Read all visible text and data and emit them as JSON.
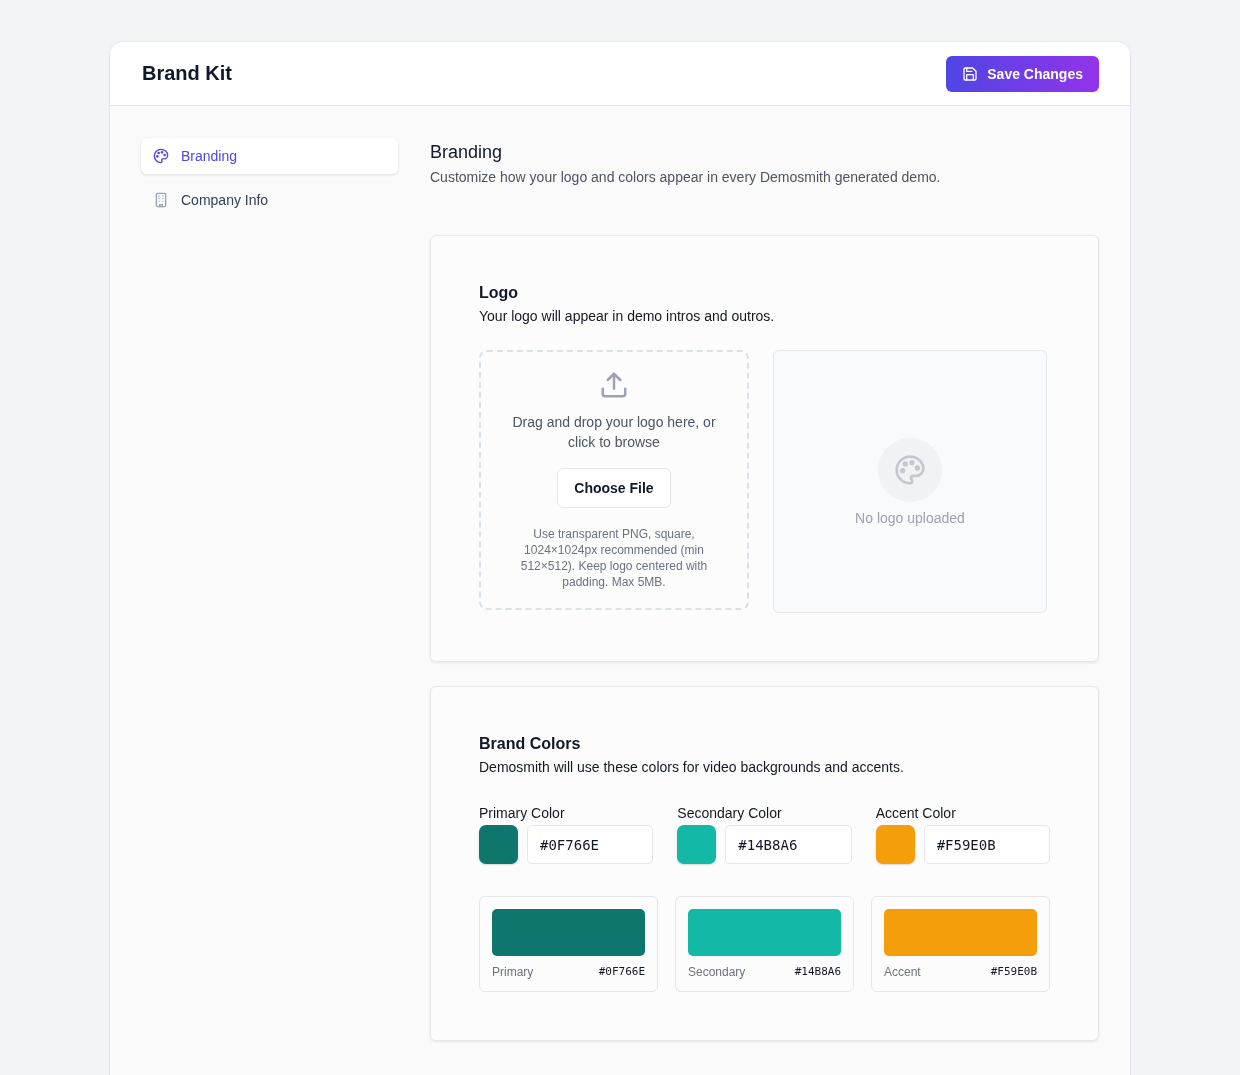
{
  "header": {
    "title": "Brand Kit",
    "save_button": "Save Changes"
  },
  "sidebar": {
    "items": [
      {
        "label": "Branding",
        "selected": true
      },
      {
        "label": "Company Info",
        "selected": false
      }
    ]
  },
  "section": {
    "title": "Branding",
    "subtitle": "Customize how your logo and colors appear in every Demosmith generated demo."
  },
  "logo": {
    "title": "Logo",
    "subtitle": "Your logo will appear in demo intros and outros.",
    "dropzone_text": "Drag and drop your logo here, or click to browse",
    "choose_button": "Choose File",
    "hint": "Use transparent PNG, square, 1024×1024px recommended (min 512×512). Keep logo centered with padding. Max 5MB.",
    "preview_empty": "No logo uploaded"
  },
  "brand_colors": {
    "title": "Brand Colors",
    "subtitle": "Demosmith will use these colors for video backgrounds and accents.",
    "fields": [
      {
        "label": "Primary Color",
        "value": "#0F766E",
        "color": "#0f766e"
      },
      {
        "label": "Secondary Color",
        "value": "#14B8A6",
        "color": "#14b8a6"
      },
      {
        "label": "Accent Color",
        "value": "#F59E0B",
        "color": "#f59e0b"
      }
    ],
    "previews": [
      {
        "name": "Primary",
        "value": "#0F766E",
        "color": "#0f766e"
      },
      {
        "name": "Secondary",
        "value": "#14B8A6",
        "color": "#14b8a6"
      },
      {
        "name": "Accent",
        "value": "#F59E0B",
        "color": "#f59e0b"
      }
    ]
  }
}
